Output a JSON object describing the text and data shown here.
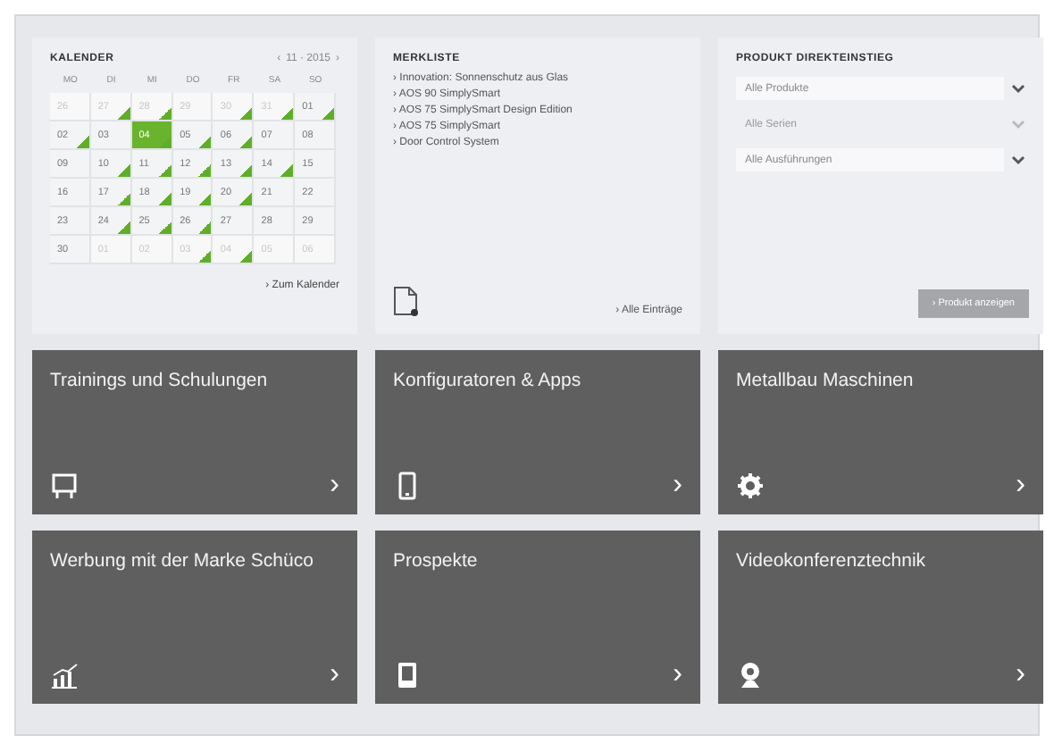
{
  "calendar": {
    "title": "KALENDER",
    "nav_prev": "‹",
    "month": "11 · 2015",
    "nav_next": "›",
    "weekdays": [
      "MO",
      "DI",
      "MI",
      "DO",
      "FR",
      "SA",
      "SO"
    ],
    "days": [
      {
        "label": "26",
        "muted": true,
        "selected": false,
        "event": false
      },
      {
        "label": "27",
        "muted": true,
        "selected": false,
        "event": true
      },
      {
        "label": "28",
        "muted": true,
        "selected": false,
        "event": true
      },
      {
        "label": "29",
        "muted": true,
        "selected": false,
        "event": false
      },
      {
        "label": "30",
        "muted": true,
        "selected": false,
        "event": true
      },
      {
        "label": "31",
        "muted": true,
        "selected": false,
        "event": true
      },
      {
        "label": "01",
        "muted": false,
        "selected": false,
        "event": true
      },
      {
        "label": "02",
        "muted": false,
        "selected": false,
        "event": true
      },
      {
        "label": "03",
        "muted": false,
        "selected": false,
        "event": false
      },
      {
        "label": "04",
        "muted": false,
        "selected": true,
        "event": true
      },
      {
        "label": "05",
        "muted": false,
        "selected": false,
        "event": true
      },
      {
        "label": "06",
        "muted": false,
        "selected": false,
        "event": true
      },
      {
        "label": "07",
        "muted": false,
        "selected": false,
        "event": false
      },
      {
        "label": "08",
        "muted": false,
        "selected": false,
        "event": false
      },
      {
        "label": "09",
        "muted": false,
        "selected": false,
        "event": false
      },
      {
        "label": "10",
        "muted": false,
        "selected": false,
        "event": true
      },
      {
        "label": "11",
        "muted": false,
        "selected": false,
        "event": true
      },
      {
        "label": "12",
        "muted": false,
        "selected": false,
        "event": true
      },
      {
        "label": "13",
        "muted": false,
        "selected": false,
        "event": true
      },
      {
        "label": "14",
        "muted": false,
        "selected": false,
        "event": true
      },
      {
        "label": "15",
        "muted": false,
        "selected": false,
        "event": false
      },
      {
        "label": "16",
        "muted": false,
        "selected": false,
        "event": false
      },
      {
        "label": "17",
        "muted": false,
        "selected": false,
        "event": true
      },
      {
        "label": "18",
        "muted": false,
        "selected": false,
        "event": true
      },
      {
        "label": "19",
        "muted": false,
        "selected": false,
        "event": true
      },
      {
        "label": "20",
        "muted": false,
        "selected": false,
        "event": true
      },
      {
        "label": "21",
        "muted": false,
        "selected": false,
        "event": false
      },
      {
        "label": "22",
        "muted": false,
        "selected": false,
        "event": false
      },
      {
        "label": "23",
        "muted": false,
        "selected": false,
        "event": false
      },
      {
        "label": "24",
        "muted": false,
        "selected": false,
        "event": true
      },
      {
        "label": "25",
        "muted": false,
        "selected": false,
        "event": true
      },
      {
        "label": "26",
        "muted": false,
        "selected": false,
        "event": true
      },
      {
        "label": "27",
        "muted": false,
        "selected": false,
        "event": false
      },
      {
        "label": "28",
        "muted": false,
        "selected": false,
        "event": false
      },
      {
        "label": "29",
        "muted": false,
        "selected": false,
        "event": false
      },
      {
        "label": "30",
        "muted": false,
        "selected": false,
        "event": false
      },
      {
        "label": "01",
        "muted": true,
        "selected": false,
        "event": false
      },
      {
        "label": "02",
        "muted": true,
        "selected": false,
        "event": false
      },
      {
        "label": "03",
        "muted": true,
        "selected": false,
        "event": true
      },
      {
        "label": "04",
        "muted": true,
        "selected": false,
        "event": true
      },
      {
        "label": "05",
        "muted": true,
        "selected": false,
        "event": false
      },
      {
        "label": "06",
        "muted": true,
        "selected": false,
        "event": false
      }
    ],
    "link": "› Zum Kalender"
  },
  "watchlist": {
    "title": "MERKLISTE",
    "items": [
      "› Innovation: Sonnenschutz aus Glas",
      "› AOS 90 SimplySmart",
      "› AOS 75 SimplySmart Design Edition",
      "› AOS 75 SimplySmart",
      "› Door Control System"
    ],
    "link": "› Alle Einträge"
  },
  "product_finder": {
    "title": "PRODUKT DIREKTEINSTIEG",
    "selects": [
      {
        "value": "Alle Produkte",
        "disabled": false
      },
      {
        "value": "Alle Serien",
        "disabled": true
      },
      {
        "value": "Alle Ausführungen",
        "disabled": false
      }
    ],
    "button": {
      "label": "› Produkt anzeigen",
      "disabled": true
    }
  },
  "tiles": [
    {
      "title": "Trainings und Schulungen",
      "arrow": "›"
    },
    {
      "title": "Konfiguratoren & Apps",
      "arrow": "›"
    },
    {
      "title": "Metallbau Maschinen",
      "arrow": "›"
    },
    {
      "title": "Werbung mit der Marke Schüco",
      "arrow": "›"
    },
    {
      "title": "Prospekte",
      "arrow": "›"
    },
    {
      "title": "Videokonferenztechnik",
      "arrow": "›"
    }
  ]
}
